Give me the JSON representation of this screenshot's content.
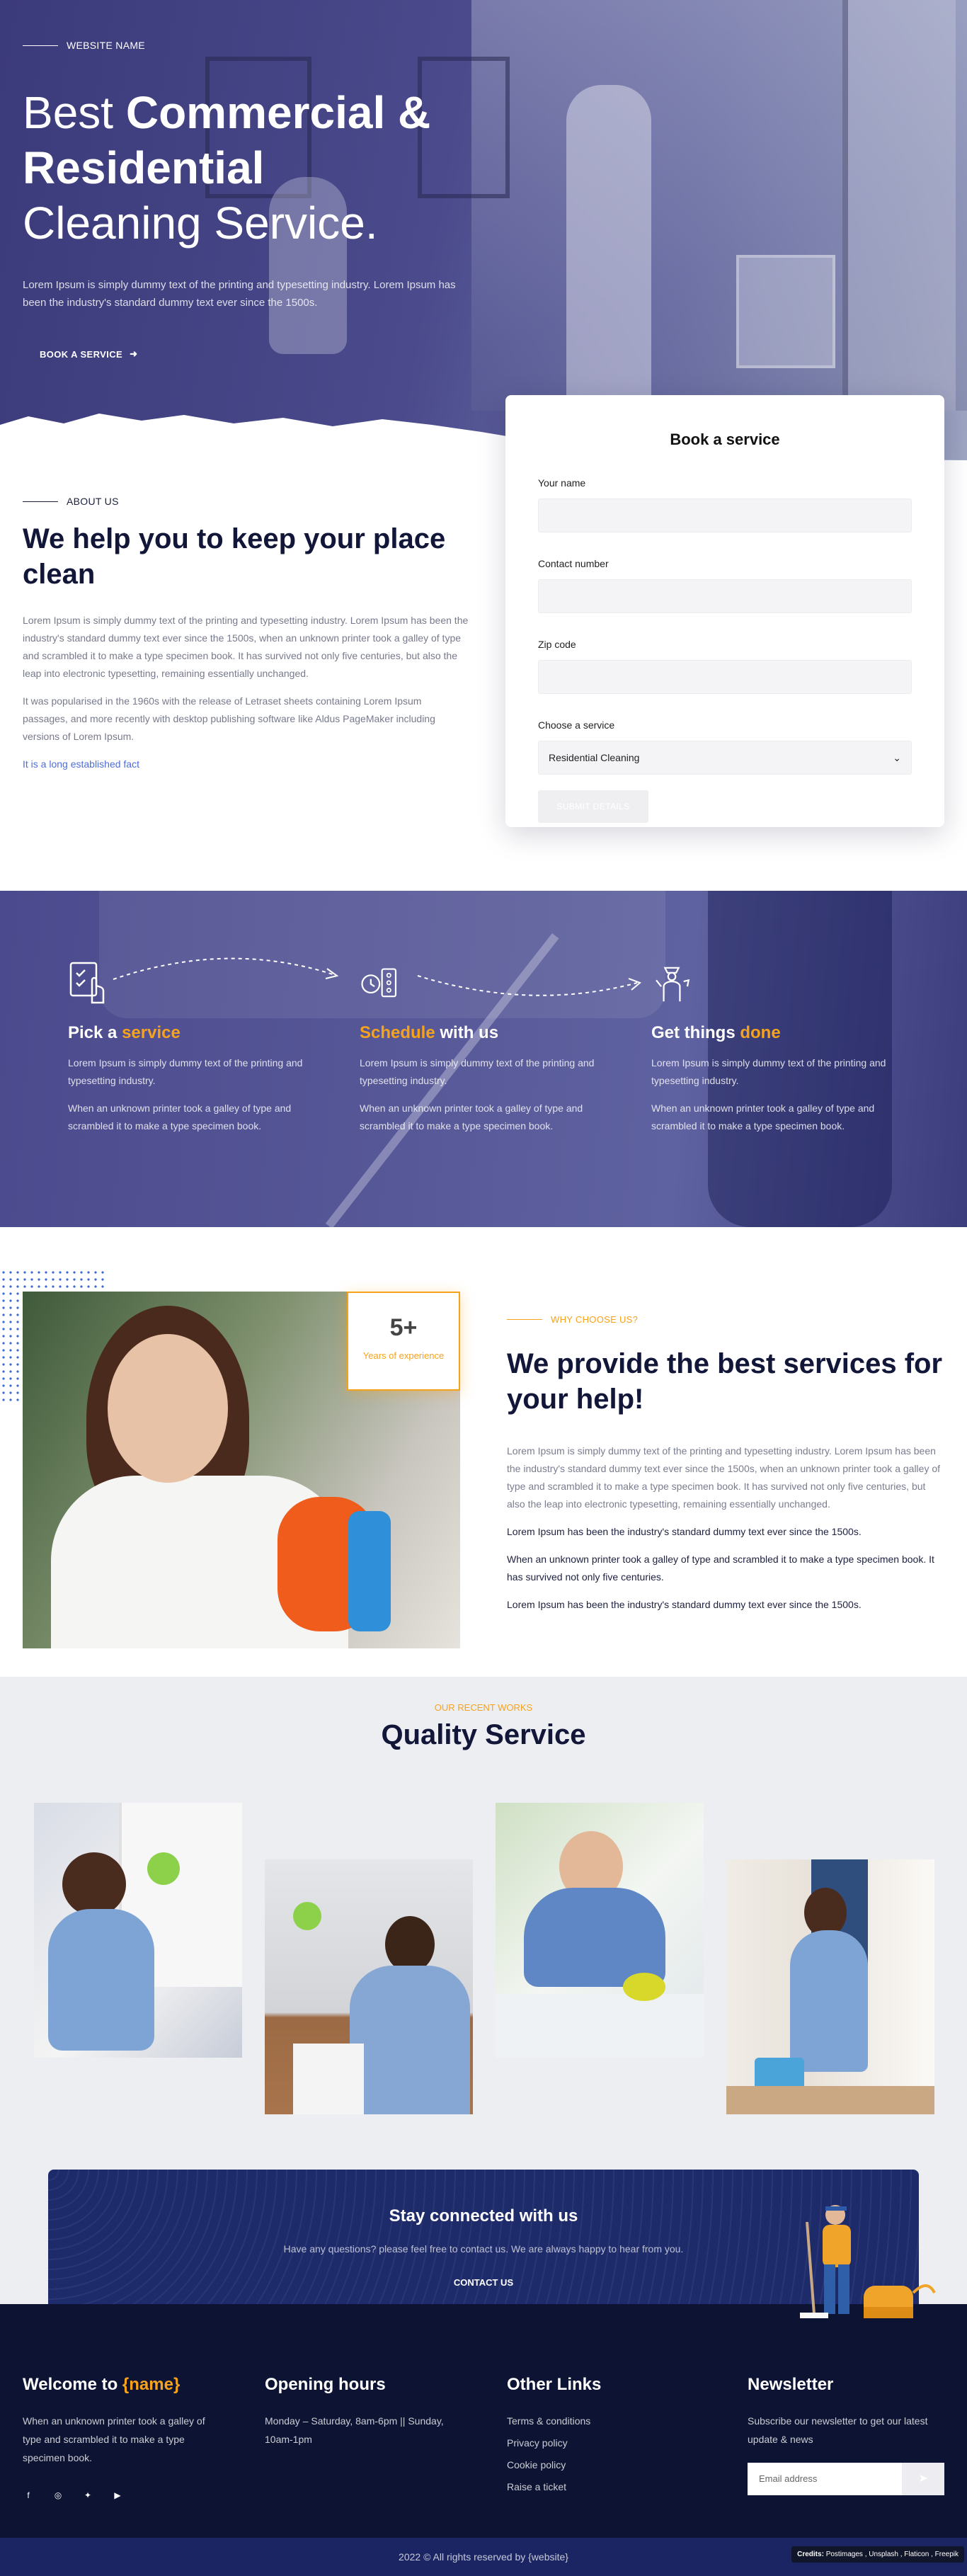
{
  "hero": {
    "eyebrow": "WEBSITE NAME",
    "title_light_1": "Best ",
    "title_bold_1": "Commercial &",
    "title_bold_2": "Residential",
    "title_light_2": "Cleaning Service.",
    "lead": "Lorem Ipsum is simply dummy text of the printing and typesetting industry. Lorem Ipsum has been the industry's standard dummy text ever since the 1500s.",
    "cta_label": "BOOK A SERVICE",
    "cta_icon": "arrow-right-icon"
  },
  "about": {
    "eyebrow": "ABOUT US",
    "title": "We help you to keep your place clean",
    "p1": "Lorem Ipsum is simply dummy text of the printing and typesetting industry. Lorem Ipsum has been the industry's standard dummy text ever since the 1500s, when an unknown printer took a galley of type and scrambled it to make a type specimen book. It has survived not only five centuries, but also the leap into electronic typesetting, remaining essentially unchanged.",
    "p2": "It was popularised in the 1960s with the release of Letraset sheets containing Lorem Ipsum passages, and more recently with desktop publishing software like Aldus PageMaker including versions of Lorem Ipsum.",
    "link": "It is a long established fact"
  },
  "booking": {
    "title": "Book a service",
    "name_label": "Your name",
    "name_value": "",
    "contact_label": "Contact number",
    "contact_value": "",
    "zip_label": "Zip code",
    "zip_value": "",
    "service_label": "Choose a service",
    "service_value": "Residential Cleaning",
    "submit_label": "SUBMIT DETAILS"
  },
  "steps": [
    {
      "title_a": "Pick a ",
      "title_b": "service",
      "accent": "b",
      "icon": "clipboard-hand-icon",
      "p1": "Lorem Ipsum is simply dummy text of the printing and typesetting industry.",
      "p2": "When an unknown printer took a galley of type and scrambled it to make a type specimen book."
    },
    {
      "title_a": "Schedule",
      "title_b": " with us",
      "accent": "a",
      "icon": "clock-schedule-icon",
      "p1": "Lorem Ipsum is simply dummy text of the printing and typesetting industry.",
      "p2": "When an unknown printer took a galley of type and scrambled it to make a type specimen book."
    },
    {
      "title_a": "Get things ",
      "title_b": "done",
      "accent": "b",
      "icon": "cleaner-person-icon",
      "p1": "Lorem Ipsum is simply dummy text of the printing and typesetting industry.",
      "p2": "When an unknown printer took a galley of type and scrambled it to make a type specimen book."
    }
  ],
  "why": {
    "badge_number": "5+",
    "badge_label": "Years of experience",
    "eyebrow": "WHY CHOOSE US?",
    "title": "We provide the best services for your help!",
    "gray": "Lorem Ipsum is simply dummy text of the printing and typesetting industry. Lorem Ipsum has been the industry's standard dummy text ever since the 1500s, when an unknown printer took a galley of type and scrambled it to make a type specimen book. It has survived not only five centuries, but also the leap into electronic typesetting, remaining essentially unchanged.",
    "d1": "Lorem Ipsum has been the industry's standard dummy text ever since the 1500s.",
    "d2": "When an unknown printer took a galley of type and scrambled it to make a type specimen book. It has survived not only five centuries.",
    "d3": "Lorem Ipsum has been the industry's standard dummy text ever since the 1500s."
  },
  "works": {
    "eyebrow": "OUR RECENT WORKS",
    "title": "Quality Service"
  },
  "stay": {
    "title": "Stay connected with us",
    "text": "Have any questions? please feel free to contact us. We are always happy to hear from you.",
    "button": "CONTACT US"
  },
  "footer": {
    "welcome_a": "Welcome to ",
    "welcome_b": "{name}",
    "welcome_text": "When an unknown printer took a galley of type and scrambled it to make a type specimen book.",
    "social": [
      "facebook-icon",
      "instagram-icon",
      "twitter-icon",
      "youtube-icon"
    ],
    "hours_title": "Opening hours",
    "hours_text": "Monday – Saturday, 8am-6pm || Sunday, 10am-1pm",
    "links_title": "Other Links",
    "links": [
      "Terms & conditions",
      "Privacy policy",
      "Cookie policy",
      "Raise a ticket"
    ],
    "news_title": "Newsletter",
    "news_text": "Subscribe our newsletter to get our latest update & news",
    "email_placeholder": "Email address",
    "copyright": "2022 © All rights reserved by {website}",
    "credits_label": "Credits:",
    "credits_text": "Postimages , Unsplash , Flaticon , Freepik"
  },
  "colors": {
    "accent": "#f7a21b",
    "navy": "#121638",
    "banner": "#1e2b6b",
    "footer": "#0d1433"
  }
}
